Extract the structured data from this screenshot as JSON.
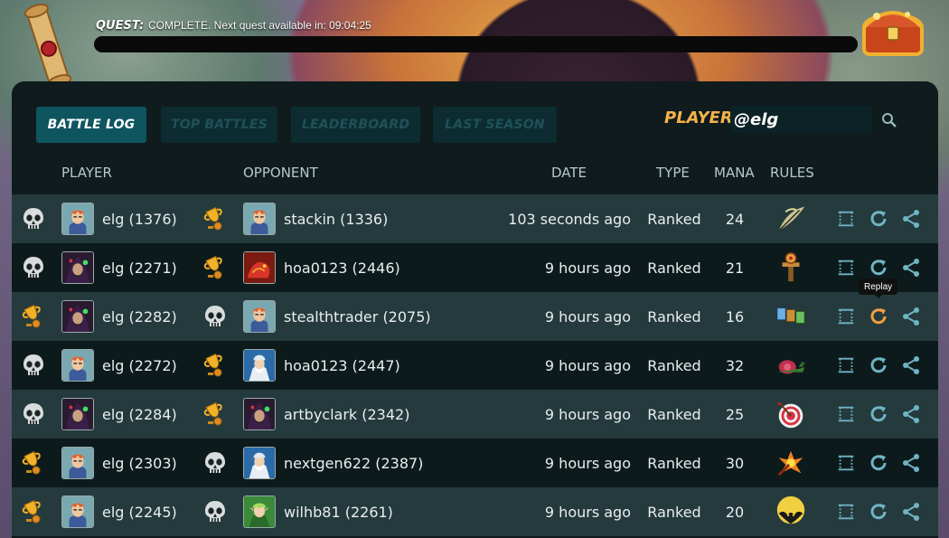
{
  "quest": {
    "label": "QUEST:",
    "status": "COMPLETE. Next quest available in: 09:04:25",
    "progress": 1.0
  },
  "tabs": [
    {
      "label": "BATTLE LOG",
      "active": true
    },
    {
      "label": "TOP BATTLES",
      "active": false
    },
    {
      "label": "LEADERBOARD",
      "active": false
    },
    {
      "label": "LAST SEASON",
      "active": false
    }
  ],
  "search": {
    "label": "PLAYER:",
    "value": "@elg",
    "icon": "search-icon"
  },
  "columns": {
    "player": "PLAYER",
    "opponent": "OPPONENT",
    "date": "DATE",
    "type": "TYPE",
    "mana": "MANA",
    "rules": "RULES"
  },
  "battles": [
    {
      "player_result": "loss",
      "player": "elg (1376)",
      "player_avatar": "wizard-blonde",
      "opponent_result": "win",
      "opponent": "stackin (1336)",
      "opponent_avatar": "wizard-blonde",
      "date": "103 seconds ago",
      "type": "Ranked",
      "mana": "24",
      "rule_icon": "feather-rule-icon"
    },
    {
      "player_result": "loss",
      "player": "elg (2271)",
      "player_avatar": "dark-mage",
      "opponent_result": "win",
      "opponent": "hoa0123 (2446)",
      "opponent_avatar": "fire-dragon",
      "date": "9 hours ago",
      "type": "Ranked",
      "mana": "21",
      "rule_icon": "totem-rule-icon"
    },
    {
      "player_result": "win",
      "player": "elg (2282)",
      "player_avatar": "dark-mage",
      "opponent_result": "loss",
      "opponent": "stealthtrader (2075)",
      "opponent_avatar": "wizard-blonde",
      "date": "9 hours ago",
      "type": "Ranked",
      "mana": "16",
      "rule_icon": "cards-rule-icon"
    },
    {
      "player_result": "loss",
      "player": "elg (2272)",
      "player_avatar": "wizard-blonde",
      "opponent_result": "win",
      "opponent": "hoa0123 (2447)",
      "opponent_avatar": "water-wizard",
      "date": "9 hours ago",
      "type": "Ranked",
      "mana": "32",
      "rule_icon": "snail-rule-icon"
    },
    {
      "player_result": "loss",
      "player": "elg (2284)",
      "player_avatar": "dark-mage",
      "opponent_result": "win",
      "opponent": "artbyclark (2342)",
      "opponent_avatar": "dark-mage",
      "date": "9 hours ago",
      "type": "Ranked",
      "mana": "25",
      "rule_icon": "target-rule-icon"
    },
    {
      "player_result": "win",
      "player": "elg (2303)",
      "player_avatar": "wizard-blonde",
      "opponent_result": "loss",
      "opponent": "nextgen622 (2387)",
      "opponent_avatar": "water-wizard",
      "date": "9 hours ago",
      "type": "Ranked",
      "mana": "30",
      "rule_icon": "explosion-rule-icon"
    },
    {
      "player_result": "win",
      "player": "elg (2245)",
      "player_avatar": "wizard-blonde",
      "opponent_result": "loss",
      "opponent": "wilhb81 (2261)",
      "opponent_avatar": "elf-ranger",
      "date": "9 hours ago",
      "type": "Ranked",
      "mana": "20",
      "rule_icon": "bat-rule-icon"
    }
  ],
  "tooltip": "Replay",
  "hovered_replay_row": 2,
  "colors": {
    "accent_orange": "#f5b24a",
    "teal": "#0f5560",
    "action_icon": "#6fb4c4",
    "replay_hover": "#f0a040"
  }
}
